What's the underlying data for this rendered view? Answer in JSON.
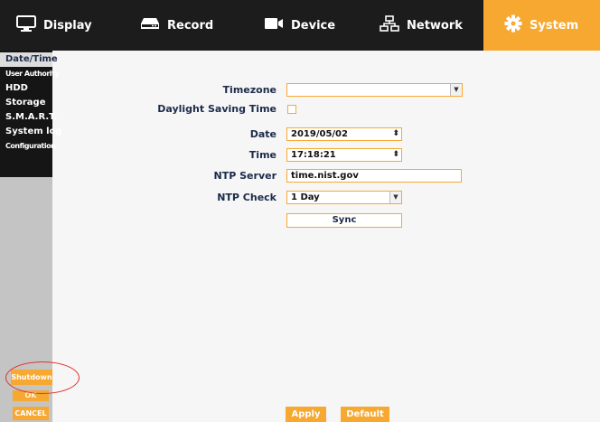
{
  "tabs": [
    {
      "label": "Display",
      "icon": "monitor-icon"
    },
    {
      "label": "Record",
      "icon": "hard-drive-icon"
    },
    {
      "label": "Device",
      "icon": "camera-icon"
    },
    {
      "label": "Network",
      "icon": "network-icon"
    },
    {
      "label": "System",
      "icon": "gear-icon",
      "active": true
    }
  ],
  "sidebar": {
    "items": [
      "Date/Time",
      "User Authority",
      "HDD",
      "Storage",
      "S.M.A.R.T.",
      "System log",
      "Configuration"
    ],
    "shutdown_label": "Shutdown",
    "ok_label": "OK",
    "cancel_label": "CANCEL"
  },
  "form": {
    "timezone_label": "Timezone",
    "timezone_value": "",
    "dst_label": "Daylight Saving Time",
    "dst_checked": false,
    "date_label": "Date",
    "date_value": "2019/05/02",
    "time_label": "Time",
    "time_value": "17:18:21",
    "ntp_server_label": "NTP Server",
    "ntp_server_value": "time.nist.gov",
    "ntp_check_label": "NTP Check",
    "ntp_check_value": "1 Day",
    "sync_label": "Sync"
  },
  "footer": {
    "apply_label": "Apply",
    "default_label": "Default"
  },
  "colors": {
    "accent": "#f7a830",
    "topbar": "#1c1c1c",
    "sidebar": "#151515",
    "annotation": "#e0322f"
  }
}
